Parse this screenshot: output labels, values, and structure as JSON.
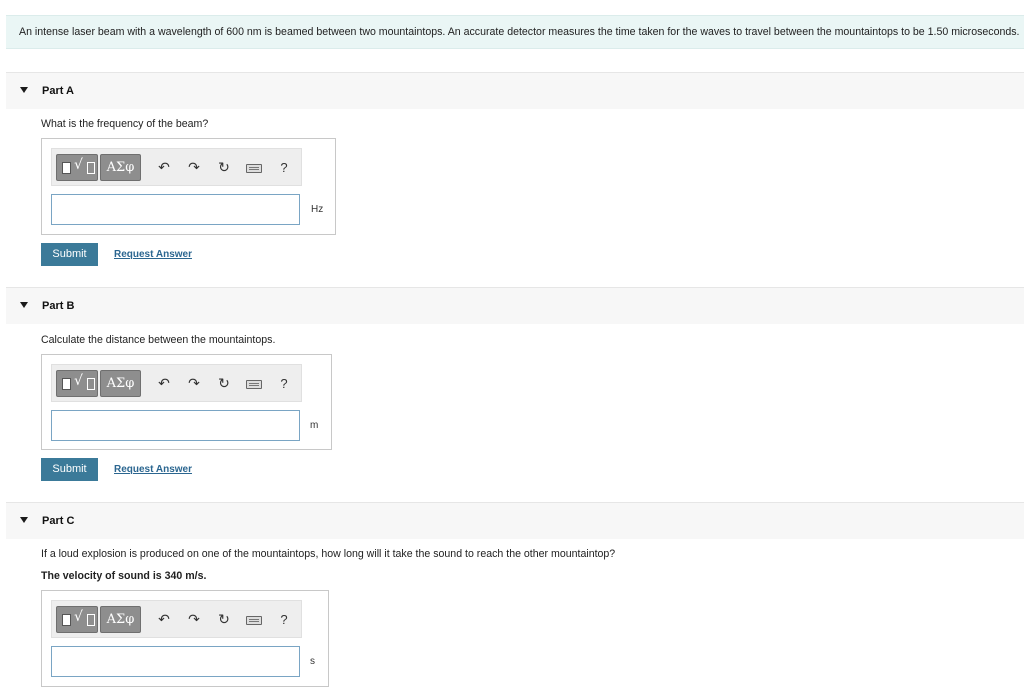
{
  "intro_text": "An intense laser beam with a wavelength of 600 nm is beamed between two mountaintops. An accurate detector measures the time taken for the waves to travel between the mountaintops to be 1.50 microseconds.",
  "toolbar": {
    "template_icon": "fraction-root-template-icon",
    "greek_label": "ΑΣφ",
    "undo_glyph": "↶",
    "redo_glyph": "↷",
    "reset_glyph": "↻",
    "help_label": "?"
  },
  "parts": [
    {
      "title": "Part A",
      "question": "What is the frequency of the beam?",
      "note": "",
      "unit": "Hz",
      "answer_value": "",
      "submit_label": "Submit",
      "request_label": "Request Answer"
    },
    {
      "title": "Part B",
      "question": "Calculate the distance between the mountaintops.",
      "note": "",
      "unit": "m",
      "answer_value": "",
      "submit_label": "Submit",
      "request_label": "Request Answer"
    },
    {
      "title": "Part C",
      "question": "If a loud explosion is produced on one of the mountaintops, how long will it take the sound to reach the other mountaintop?",
      "note": "The velocity of sound is 340 m/s.",
      "unit": "s",
      "answer_value": ""
    }
  ],
  "colors": {
    "intro_bg": "#eaf6f5",
    "submit_bg": "#3b7a99",
    "link": "#2b6690",
    "input_border": "#7aa5c4"
  }
}
